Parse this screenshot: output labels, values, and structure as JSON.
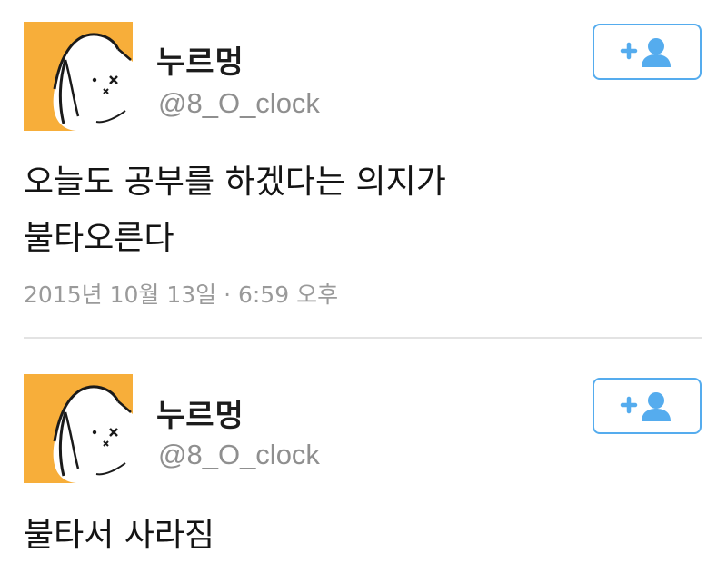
{
  "tweets": [
    {
      "user": {
        "display_name": "누르멍",
        "handle": "@8_O_clock",
        "avatar_icon": "cartoon-dog-avatar",
        "avatar_bg": "#f7ae3a"
      },
      "follow_icon": "follow-user-icon",
      "text": "오늘도 공부를 하겠다는 의지가\n불타오른다",
      "timestamp": "2015년 10월 13일 · 6:59 오후"
    },
    {
      "user": {
        "display_name": "누르멍",
        "handle": "@8_O_clock",
        "avatar_icon": "cartoon-dog-avatar",
        "avatar_bg": "#f7ae3a"
      },
      "follow_icon": "follow-user-icon",
      "text": "불타서 사라짐"
    }
  ],
  "colors": {
    "accent": "#55acee",
    "name": "#1c1c1c",
    "muted": "#8f8f8f"
  }
}
